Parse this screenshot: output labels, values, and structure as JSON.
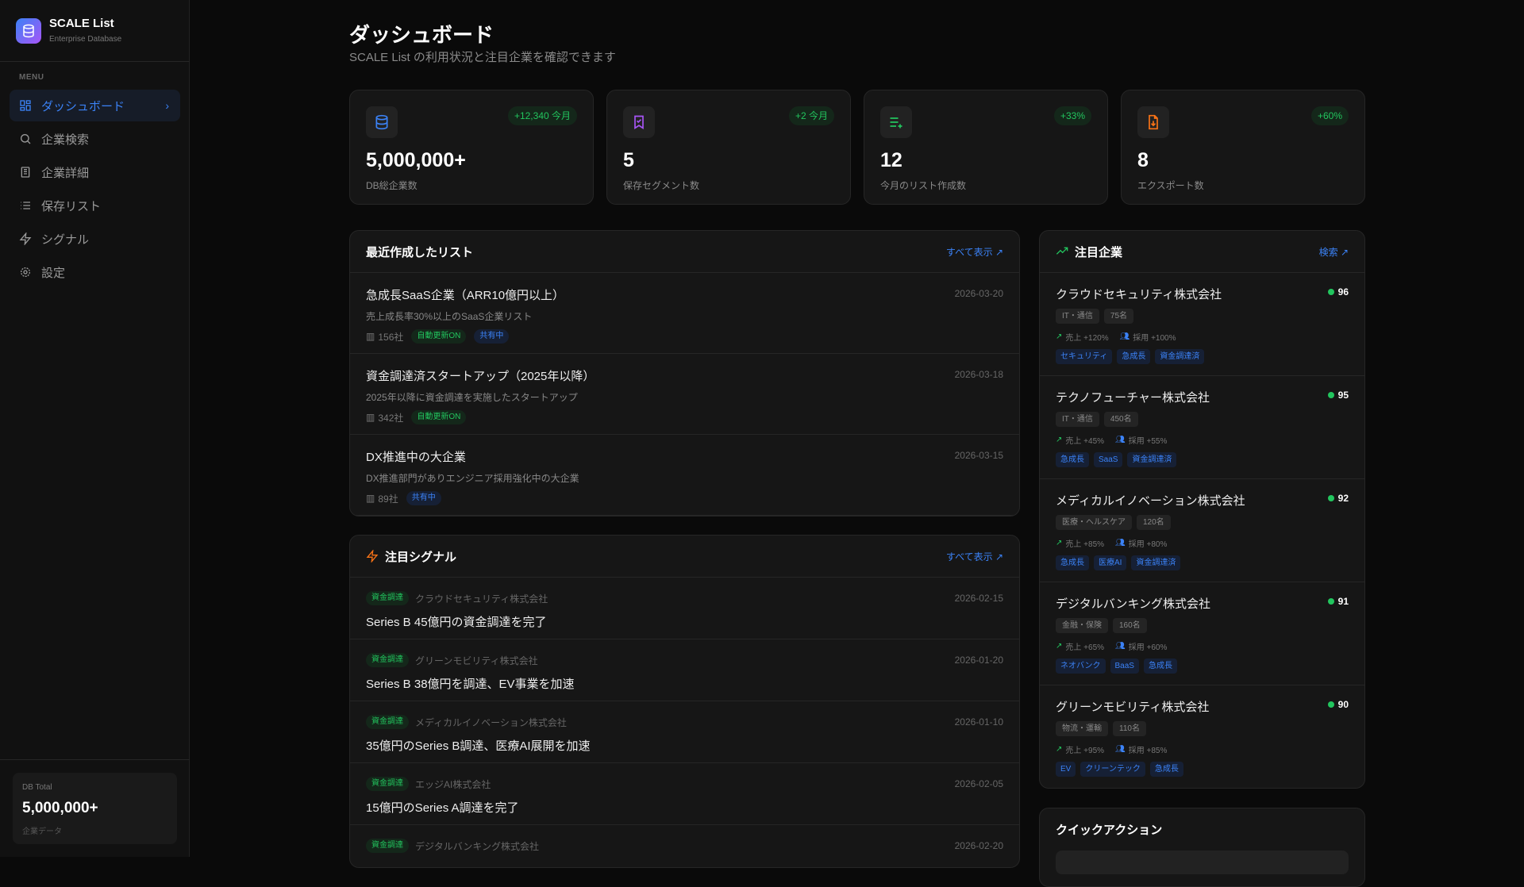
{
  "brand": {
    "name": "SCALE List",
    "sub": "Enterprise Database"
  },
  "menu_label": "MENU",
  "nav": [
    {
      "label": "ダッシュボード"
    },
    {
      "label": "企業検索"
    },
    {
      "label": "企業詳細"
    },
    {
      "label": "保存リスト"
    },
    {
      "label": "シグナル"
    },
    {
      "label": "設定"
    }
  ],
  "db_box": {
    "label": "DB Total",
    "value": "5,000,000+",
    "sub": "企業データ"
  },
  "header": {
    "title": "ダッシュボード",
    "subtitle": "SCALE List の利用状況と注目企業を確認できます"
  },
  "stats": [
    {
      "badge": "+12,340 今月",
      "value": "5,000,000+",
      "label": "DB総企業数",
      "icon": "database-icon",
      "color": "#3b82f6"
    },
    {
      "badge": "+2 今月",
      "value": "5",
      "label": "保存セグメント数",
      "icon": "bookmark-check-icon",
      "color": "#a855f7"
    },
    {
      "badge": "+33%",
      "value": "12",
      "label": "今月のリスト作成数",
      "icon": "list-plus-icon",
      "color": "#22c55e"
    },
    {
      "badge": "+60%",
      "value": "8",
      "label": "エクスポート数",
      "icon": "file-download-icon",
      "color": "#f97316"
    }
  ],
  "recent_lists": {
    "title": "最近作成したリスト",
    "link": "すべて表示",
    "items": [
      {
        "name": "急成長SaaS企業（ARR10億円以上）",
        "desc": "売上成長率30%以上のSaaS企業リスト",
        "date": "2026-03-20",
        "count": "156社",
        "auto": "自動更新ON",
        "shared": "共有中"
      },
      {
        "name": "資金調達済スタートアップ（2025年以降）",
        "desc": "2025年以降に資金調達を実施したスタートアップ",
        "date": "2026-03-18",
        "count": "342社",
        "auto": "自動更新ON"
      },
      {
        "name": "DX推進中の大企業",
        "desc": "DX推進部門がありエンジニア採用強化中の大企業",
        "date": "2026-03-15",
        "count": "89社",
        "shared": "共有中"
      }
    ]
  },
  "signals": {
    "title": "注目シグナル",
    "link": "すべて表示",
    "items": [
      {
        "tag": "資金調達",
        "company": "クラウドセキュリティ株式会社",
        "text": "Series B 45億円の資金調達を完了",
        "date": "2026-02-15"
      },
      {
        "tag": "資金調達",
        "company": "グリーンモビリティ株式会社",
        "text": "Series B 38億円を調達、EV事業を加速",
        "date": "2026-01-20"
      },
      {
        "tag": "資金調達",
        "company": "メディカルイノベーション株式会社",
        "text": "35億円のSeries B調達、医療AI展開を加速",
        "date": "2026-01-10"
      },
      {
        "tag": "資金調達",
        "company": "エッジAI株式会社",
        "text": "15億円のSeries A調達を完了",
        "date": "2026-02-05"
      },
      {
        "tag": "資金調達",
        "company": "デジタルバンキング株式会社",
        "date": "2026-02-20"
      }
    ]
  },
  "featured": {
    "title": "注目企業",
    "link": "検索",
    "items": [
      {
        "name": "クラウドセキュリティ株式会社",
        "score": "96",
        "industry": "IT・通信",
        "employees": "75名",
        "sales": "売上 +120%",
        "hiring": "採用 +100%",
        "tags": [
          "セキュリティ",
          "急成長",
          "資金調達済"
        ]
      },
      {
        "name": "テクノフューチャー株式会社",
        "score": "95",
        "industry": "IT・通信",
        "employees": "450名",
        "sales": "売上 +45%",
        "hiring": "採用 +55%",
        "tags": [
          "急成長",
          "SaaS",
          "資金調達済"
        ]
      },
      {
        "name": "メディカルイノベーション株式会社",
        "score": "92",
        "industry": "医療・ヘルスケア",
        "employees": "120名",
        "sales": "売上 +85%",
        "hiring": "採用 +80%",
        "tags": [
          "急成長",
          "医療AI",
          "資金調達済"
        ]
      },
      {
        "name": "デジタルバンキング株式会社",
        "score": "91",
        "industry": "金融・保険",
        "employees": "160名",
        "sales": "売上 +65%",
        "hiring": "採用 +60%",
        "tags": [
          "ネオバンク",
          "BaaS",
          "急成長"
        ]
      },
      {
        "name": "グリーンモビリティ株式会社",
        "score": "90",
        "industry": "物流・運輸",
        "employees": "110名",
        "sales": "売上 +95%",
        "hiring": "採用 +85%",
        "tags": [
          "EV",
          "クリーンテック",
          "急成長"
        ]
      }
    ]
  },
  "quick_actions": {
    "title": "クイックアクション"
  }
}
